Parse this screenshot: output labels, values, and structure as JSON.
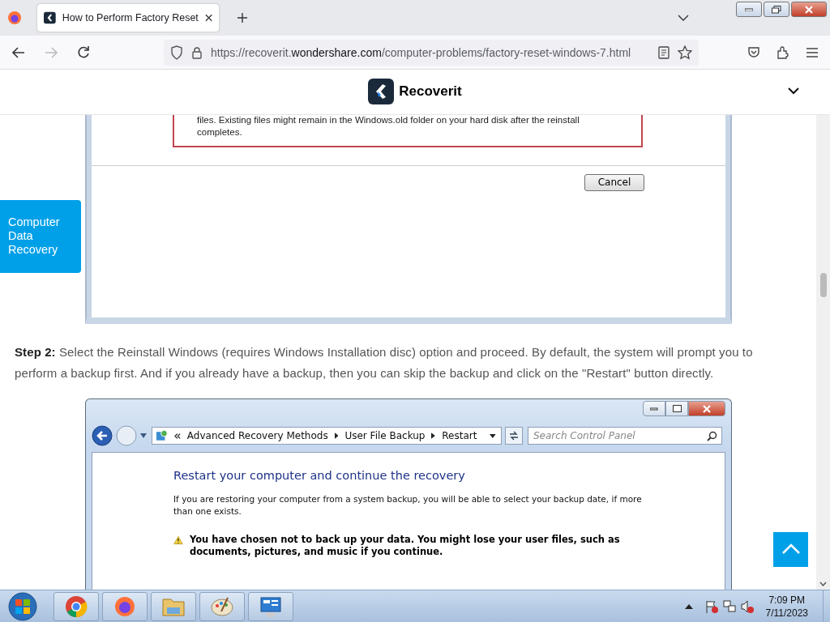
{
  "browser": {
    "tab_title": "How to Perform Factory Reset",
    "url": {
      "prefix": "https://recoverit.",
      "domain": "wondershare.com",
      "path": "/computer-problems/factory-reset-windows-7.html"
    }
  },
  "site_header": {
    "brand": "Recoverit"
  },
  "side_tab": {
    "label": "Computer Data Recovery"
  },
  "screenshot_1": {
    "warning_text": "files. Existing files might remain in the Windows.old folder on your hard disk after the reinstall completes.",
    "button": "Cancel"
  },
  "step": {
    "text": "**Step 2:** Select the Reinstall Windows (requires Windows Installation disc) option and proceed. By default, the system will prompt you to perform a backup first. And if you already have a backup, then you can skip the backup and click on the \"Restart\" button directly."
  },
  "screenshot_2": {
    "breadcrumb": [
      "Advanced Recovery Methods",
      "User File Backup",
      "Restart"
    ],
    "search": {
      "placeholder": "Search Control Panel"
    },
    "heading": "Restart your computer and continue the recovery",
    "body": "If you are restoring your computer from a system backup, you will be able to select your backup date, if more than one exists.",
    "warning": "You have chosen not to back up your data. You might lose your user files, such as documents, pictures, and music if you continue."
  },
  "taskbar": {
    "time": "7:09 PM",
    "date": "7/11/2023"
  }
}
